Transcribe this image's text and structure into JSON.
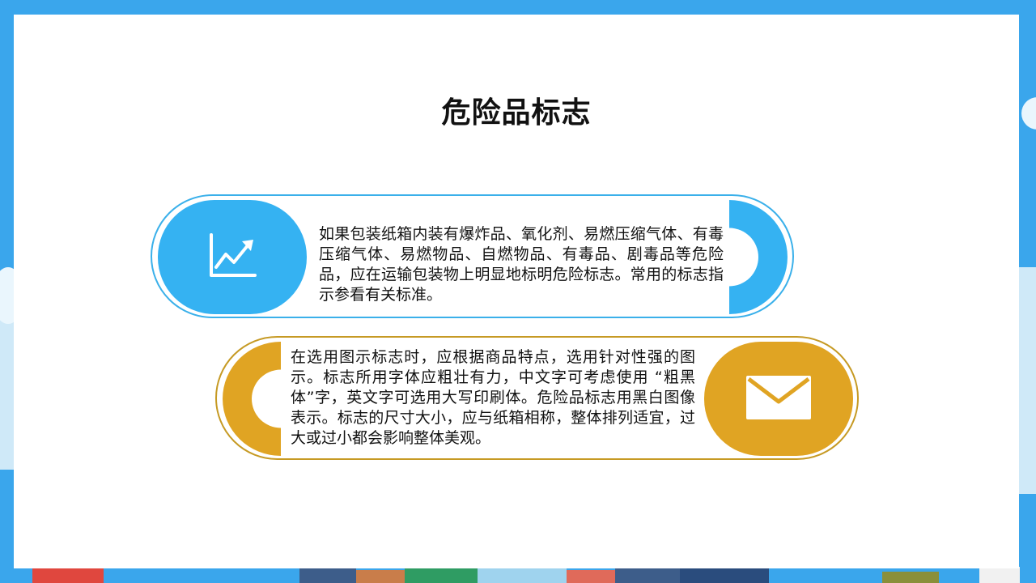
{
  "slide": {
    "title": "危险品标志"
  },
  "cards": [
    {
      "icon": "chart-line-up-icon",
      "text": "如果包装纸箱内装有爆炸品、氧化剂、易燃压缩气体、有毒压缩气体、易燃物品、自燃物品、有毒品、剧毒品等危险品，应在运输包装物上明显地标明危险标志。常用的标志指示参看有关标准。",
      "accent": "#35b2f2"
    },
    {
      "icon": "envelope-icon",
      "text": "在选用图示标志时，应根据商品特点，选用针对性强的图示。标志所用字体应粗壮有力，中文字可考虑使用 “粗黑体”字，英文字可选用大写印刷体。危险品标志用黑白图像表示。标志的尺寸大小，应与纸箱相称，整体排列适宜，过大或过小都会影响整体美观。",
      "accent": "#e0a423"
    }
  ]
}
